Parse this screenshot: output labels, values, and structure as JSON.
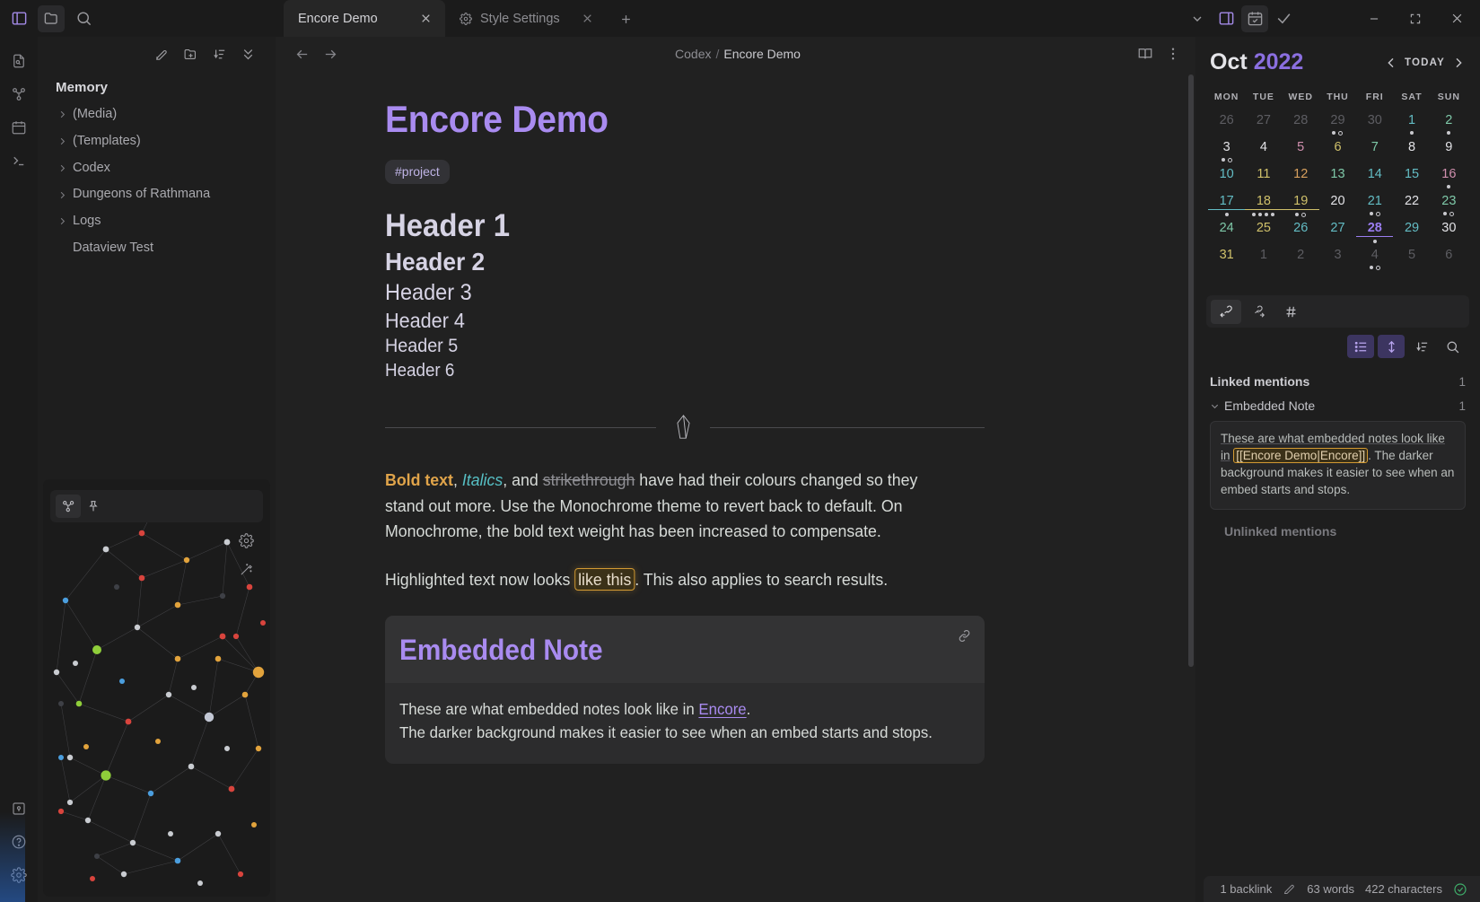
{
  "titlebar": {
    "tabs": [
      {
        "label": "Encore Demo",
        "icon": "",
        "active": true
      },
      {
        "label": "Style Settings",
        "icon": "gear-icon",
        "active": false
      }
    ],
    "new_tab_label": "+",
    "window_controls": {
      "minimize": "minimize-icon",
      "maximize": "maximize-icon",
      "close": "close-icon"
    }
  },
  "sidebar": {
    "toolbar": [
      "new-note-icon",
      "new-folder-icon",
      "sort-icon",
      "collapse-icon"
    ],
    "root_label": "Memory",
    "items": [
      {
        "label": "(Media)",
        "type": "folder"
      },
      {
        "label": "(Templates)",
        "type": "folder"
      },
      {
        "label": "Codex",
        "type": "folder"
      },
      {
        "label": "Dungeons of Rathmana",
        "type": "folder"
      },
      {
        "label": "Logs",
        "type": "folder"
      },
      {
        "label": "Dataview Test",
        "type": "file"
      }
    ],
    "graph": {
      "toolbar": [
        "graph-icon",
        "pin-icon"
      ],
      "corner": [
        "gear-icon",
        "wand-icon"
      ]
    }
  },
  "editor": {
    "breadcrumb": {
      "parent": "Codex",
      "separator": "/",
      "current": "Encore Demo"
    },
    "note_title": "Encore Demo",
    "tag": "#project",
    "headers": [
      {
        "level": 1,
        "text": "Header 1"
      },
      {
        "level": 2,
        "text": "Header 2"
      },
      {
        "level": 3,
        "text": "Header 3"
      },
      {
        "level": 4,
        "text": "Header 4"
      },
      {
        "level": 5,
        "text": "Header 5"
      },
      {
        "level": 6,
        "text": "Header 6"
      }
    ],
    "paragraph1": {
      "bold": "Bold text",
      "c1": ", ",
      "italic": "Italics",
      "c2": ", and ",
      "strike": "strikethrough",
      "rest": " have had their colours changed so they stand out more. Use the Monochrome theme to revert back to default. On Monochrome, the bold text weight has been increased to compensate."
    },
    "paragraph2": {
      "pre": "Highlighted text now looks ",
      "highlight": "like this",
      "post": ". This also applies to search results."
    },
    "embed": {
      "title": "Embedded Note",
      "line1_pre": "These are what embedded notes look like in ",
      "line1_link": "Encore",
      "line1_post": ".",
      "line2": "The darker background makes it easier to see when an embed starts and stops."
    }
  },
  "calendar": {
    "month": "Oct",
    "year": "2022",
    "today_label": "TODAY",
    "weekdays": [
      "MON",
      "TUE",
      "WED",
      "THU",
      "FRI",
      "SAT",
      "SUN"
    ],
    "weeks": [
      [
        {
          "n": "26",
          "cls": "d-dim",
          "dots": []
        },
        {
          "n": "27",
          "cls": "d-dim",
          "dots": []
        },
        {
          "n": "28",
          "cls": "d-dim",
          "dots": []
        },
        {
          "n": "29",
          "cls": "d-dim",
          "dots": [
            "solid",
            "hollow"
          ]
        },
        {
          "n": "30",
          "cls": "d-dim",
          "dots": []
        },
        {
          "n": "1",
          "cls": "d-cyan",
          "dots": [
            "solid"
          ]
        },
        {
          "n": "2",
          "cls": "d-green",
          "dots": [
            "solid"
          ]
        }
      ],
      [
        {
          "n": "3",
          "cls": "d-white",
          "dots": [
            "solid",
            "hollow"
          ]
        },
        {
          "n": "4",
          "cls": "d-white",
          "dots": []
        },
        {
          "n": "5",
          "cls": "d-pink",
          "dots": []
        },
        {
          "n": "6",
          "cls": "d-yellow",
          "dots": []
        },
        {
          "n": "7",
          "cls": "d-green",
          "dots": []
        },
        {
          "n": "8",
          "cls": "d-white",
          "dots": []
        },
        {
          "n": "9",
          "cls": "d-white",
          "dots": []
        }
      ],
      [
        {
          "n": "10",
          "cls": "d-cyan",
          "dots": []
        },
        {
          "n": "11",
          "cls": "d-yellow",
          "dots": []
        },
        {
          "n": "12",
          "cls": "d-orange",
          "dots": []
        },
        {
          "n": "13",
          "cls": "d-green",
          "dots": []
        },
        {
          "n": "14",
          "cls": "d-cyan",
          "dots": []
        },
        {
          "n": "15",
          "cls": "d-cyan",
          "dots": []
        },
        {
          "n": "16",
          "cls": "d-pink",
          "dots": [
            "solid"
          ]
        }
      ],
      [
        {
          "n": "17",
          "cls": "d-cyan d-uline",
          "dots": [
            "solid"
          ]
        },
        {
          "n": "18",
          "cls": "d-yellow d-uline",
          "dots": [
            "solid",
            "solid",
            "solid",
            "solid"
          ]
        },
        {
          "n": "19",
          "cls": "d-yellow d-uline",
          "dots": [
            "solid",
            "hollow"
          ]
        },
        {
          "n": "20",
          "cls": "d-white",
          "dots": []
        },
        {
          "n": "21",
          "cls": "d-cyan",
          "dots": [
            "solid",
            "hollow"
          ]
        },
        {
          "n": "22",
          "cls": "d-white",
          "dots": []
        },
        {
          "n": "23",
          "cls": "d-green",
          "dots": [
            "solid",
            "hollow"
          ]
        }
      ],
      [
        {
          "n": "24",
          "cls": "d-green",
          "dots": []
        },
        {
          "n": "25",
          "cls": "d-yellow",
          "dots": []
        },
        {
          "n": "26",
          "cls": "d-cyan",
          "dots": []
        },
        {
          "n": "27",
          "cls": "d-cyan",
          "dots": []
        },
        {
          "n": "28",
          "cls": "d-today",
          "dots": [
            "solid"
          ]
        },
        {
          "n": "29",
          "cls": "d-cyan",
          "dots": []
        },
        {
          "n": "30",
          "cls": "d-white",
          "dots": []
        }
      ],
      [
        {
          "n": "31",
          "cls": "d-yellow",
          "dots": []
        },
        {
          "n": "1",
          "cls": "d-dim",
          "dots": []
        },
        {
          "n": "2",
          "cls": "d-dim",
          "dots": []
        },
        {
          "n": "3",
          "cls": "d-dim",
          "dots": []
        },
        {
          "n": "4",
          "cls": "d-dim",
          "dots": [
            "solid",
            "hollow"
          ]
        },
        {
          "n": "5",
          "cls": "d-dim",
          "dots": []
        },
        {
          "n": "6",
          "cls": "d-dim",
          "dots": []
        }
      ]
    ]
  },
  "backlinks": {
    "tabs": [
      "backlink-icon",
      "outgoing-link-icon",
      "tag-icon"
    ],
    "tools": [
      "list-icon",
      "expand-icon",
      "sort-icon",
      "search-icon"
    ],
    "linked_label": "Linked mentions",
    "linked_count": "1",
    "note_label": "Embedded Note",
    "note_count": "1",
    "preview": {
      "line1": "These are what embedded notes look like in",
      "wikilink": "[[Encore Demo|Encore]]",
      "trailing": ".",
      "line2": "The darker background makes it easier to see when an embed starts and stops."
    },
    "unlinked_label": "Unlinked mentions"
  },
  "statusbar": {
    "backlinks": "1 backlink",
    "edit_icon": "pencil-icon",
    "words": "63 words",
    "characters": "422 characters",
    "sync_icon": "check-circle-icon"
  },
  "colors": {
    "accent": "#a98bf0",
    "bold": "#e0a44a",
    "italic": "#56bfc4",
    "highlight_border": "#d39a33",
    "today": "#9a7df0"
  }
}
